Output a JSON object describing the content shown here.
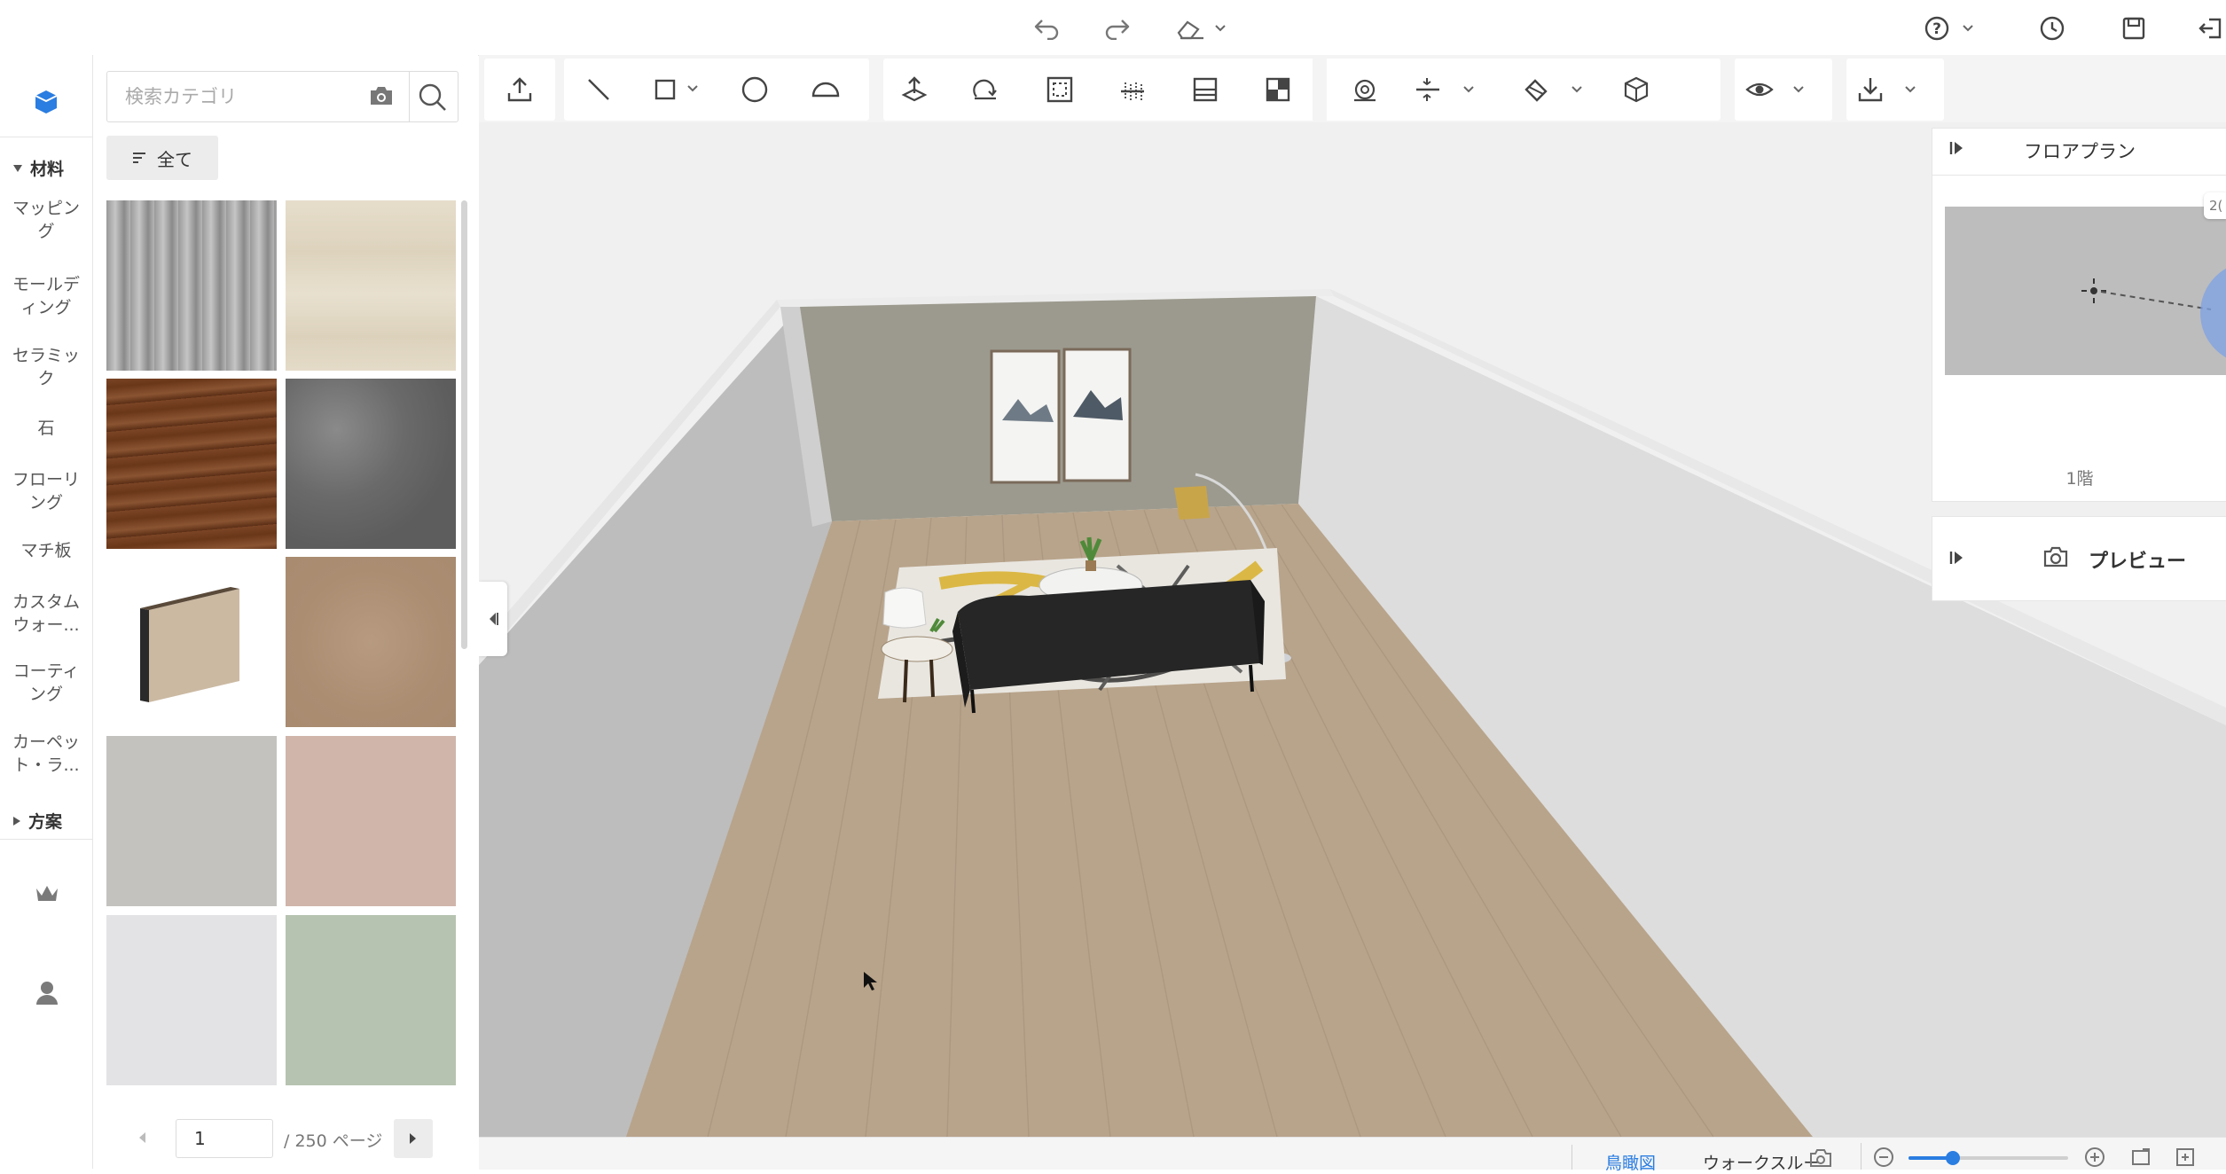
{
  "topbar": {
    "icons": [
      "undo-icon",
      "redo-icon",
      "eraser-icon",
      "help-icon",
      "history-icon",
      "save-icon",
      "exit-icon"
    ]
  },
  "rail": {
    "section_materials": "材料",
    "items": [
      "マッピング",
      "モールディング",
      "セラミック",
      "石",
      "フローリング",
      "マチ板",
      "カスタムウォー...",
      "コーティング",
      "カーペット・ラ..."
    ],
    "section_plans": "方案"
  },
  "panel": {
    "search_placeholder": "検索カテゴリ",
    "all_button": "全て",
    "pager": {
      "current_page": "1",
      "total_label": "/ 250 ページ"
    },
    "tiles": [
      {
        "name": "grey-vertical-slats",
        "color": "#8f8f8f"
      },
      {
        "name": "cream-wood-planks",
        "color": "#e2d9c7"
      },
      {
        "name": "dark-walnut-wood",
        "color": "#7a4524"
      },
      {
        "name": "dark-grey-marble",
        "color": "#6b6b6b"
      },
      {
        "name": "stone-board-3d",
        "color": "#ffffff"
      },
      {
        "name": "brown-sand-texture",
        "color": "#b2927a"
      },
      {
        "name": "light-grey-concrete",
        "color": "#c4c2bf"
      },
      {
        "name": "pink-beige-plaster",
        "color": "#cfb5aa"
      },
      {
        "name": "light-grey-paint",
        "color": "#e3e3e6"
      },
      {
        "name": "sage-green-paint",
        "color": "#b6c3b0"
      }
    ]
  },
  "floorplan": {
    "title": "フロアプラン",
    "floor_label": "1階",
    "scale_label": "2("
  },
  "preview": {
    "title": "プレビュー"
  },
  "bottombar": {
    "view_birdseye": "鳥瞰図",
    "view_walkthrough": "ウォークスルー",
    "zoom_level": 0.28
  },
  "colors": {
    "accent": "#2a7de1",
    "viewport_bg": "#f0f0f0",
    "floor": "#b8a48b",
    "back_wall": "#9c9a8e"
  }
}
